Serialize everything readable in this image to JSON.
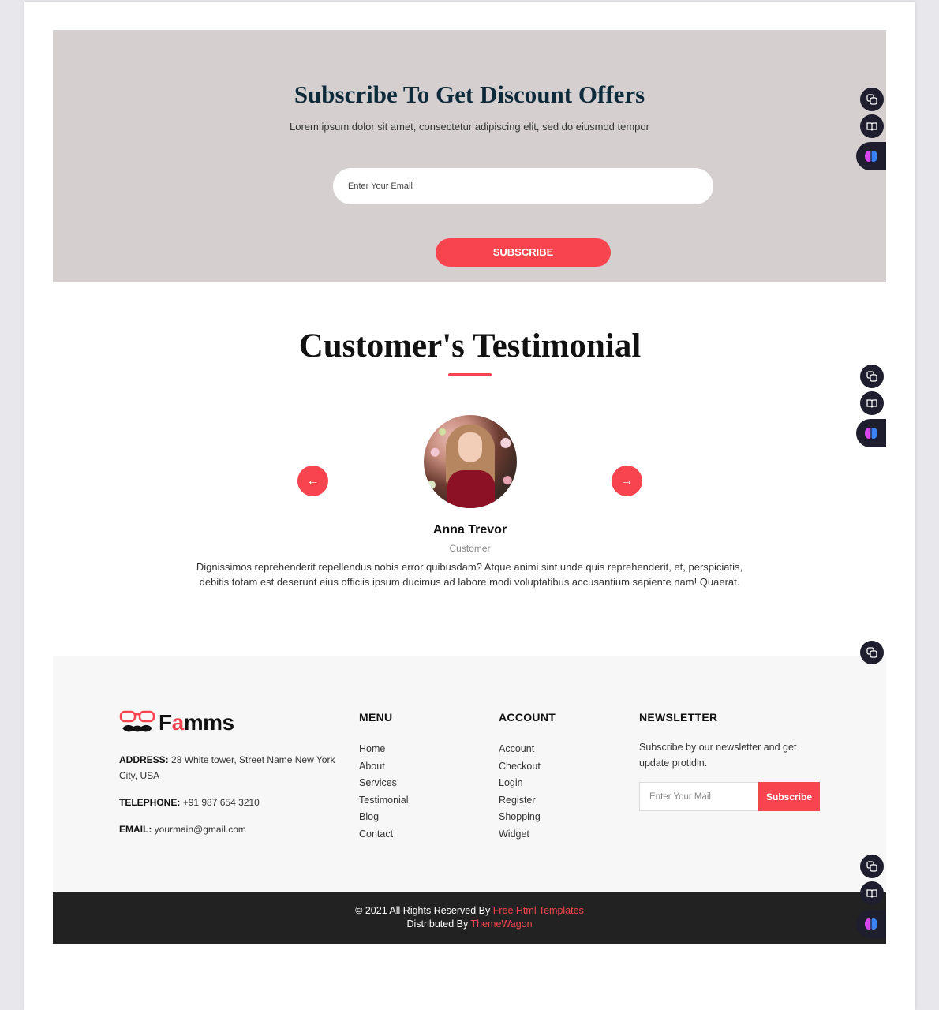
{
  "subscribe": {
    "title": "Subscribe To Get Discount Offers",
    "text": "Lorem ipsum dolor sit amet, consectetur adipiscing elit, sed do eiusmod tempor",
    "email_placeholder": "Enter Your Email",
    "button_label": "SUBSCRIBE"
  },
  "testimonial": {
    "title": "Customer's Testimonial",
    "prev_icon": "arrow-left-icon",
    "next_icon": "arrow-right-icon",
    "prev_glyph": "←",
    "next_glyph": "→",
    "name": "Anna Trevor",
    "role": "Customer",
    "text": "Dignissimos reprehenderit repellendus nobis error quibusdam? Atque animi sint unde quis reprehenderit, et, perspiciatis, debitis totam est deserunt eius officiis ipsum ducimus ad labore modi voluptatibus accusantium sapiente nam! Quaerat."
  },
  "footer": {
    "logo": {
      "prefix": "F",
      "accent": "a",
      "suffix": "mms"
    },
    "address_label": "ADDRESS:",
    "address": "28 White tower, Street Name New York City, USA",
    "telephone_label": "TELEPHONE:",
    "telephone": "+91 987 654 3210",
    "email_label": "EMAIL:",
    "email": "yourmain@gmail.com",
    "menu": {
      "title": "MENU",
      "items": [
        "Home",
        "About",
        "Services",
        "Testimonial",
        "Blog",
        "Contact"
      ]
    },
    "account": {
      "title": "ACCOUNT",
      "items": [
        "Account",
        "Checkout",
        "Login",
        "Register",
        "Shopping",
        "Widget"
      ]
    },
    "newsletter": {
      "title": "NEWSLETTER",
      "text": "Subscribe by our newsletter and get update protidin.",
      "placeholder": "Enter Your Mail",
      "button_label": "Subscribe"
    }
  },
  "copyright": {
    "line1_prefix": "© 2021 All Rights Reserved By ",
    "line1_link": "Free Html Templates",
    "line2_prefix": "Distributed By ",
    "line2_link": "ThemeWagon"
  },
  "colors": {
    "accent": "#f7444e",
    "subscribe_bg": "#d6cfd0",
    "footer_bg": "#f7f7f7",
    "copyright_bg": "#222222",
    "heading_navy": "#0e2b3c"
  },
  "widgets": {
    "icons": [
      "translate-icon",
      "reader-icon",
      "brain-icon"
    ]
  }
}
